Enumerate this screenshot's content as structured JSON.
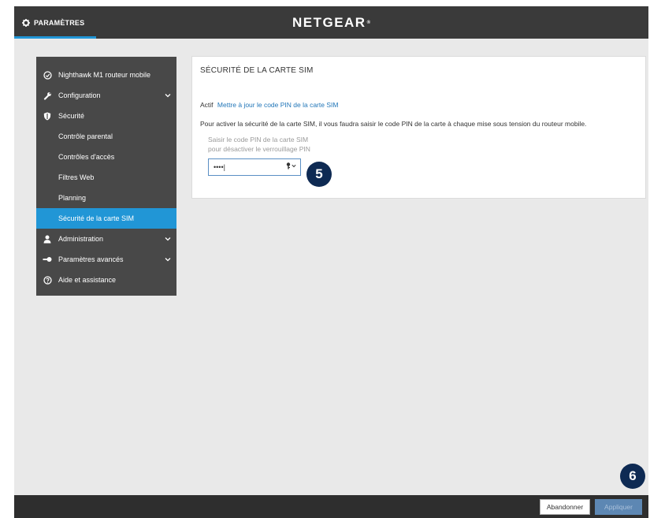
{
  "header": {
    "settings_tab": "PARAMÈTRES",
    "brand": "NETGEAR",
    "brand_mark": "®"
  },
  "sidebar": {
    "items": [
      {
        "label": "Nighthawk M1 routeur mobile",
        "icon": "dashboard-icon"
      },
      {
        "label": "Configuration",
        "icon": "wrench-icon",
        "expandable": true
      },
      {
        "label": "Sécurité",
        "icon": "shield-icon"
      },
      {
        "label": "Contrôle parental"
      },
      {
        "label": "Contrôles d'accès"
      },
      {
        "label": "Filtres Web"
      },
      {
        "label": "Planning"
      },
      {
        "label": "Sécurité de la carte SIM",
        "active": true
      },
      {
        "label": "Administration",
        "icon": "user-icon",
        "expandable": true
      },
      {
        "label": "Paramètres avancés",
        "icon": "key-icon",
        "expandable": true
      },
      {
        "label": "Aide et assistance",
        "icon": "help-icon"
      }
    ]
  },
  "panel": {
    "title": "SÉCURITÉ DE LA CARTE SIM",
    "status": "Actif",
    "update_link": "Mettre à jour le code PIN de la carte SIM",
    "description": "Pour activer la sécurité de la carte SIM, il vous faudra saisir le code PIN de la carte à chaque mise sous tension du routeur mobile.",
    "pin_label": "Saisir le code PIN de la carte SIM pour désactiver le verrouillage PIN",
    "pin_value": "••••|"
  },
  "badges": {
    "step5": "5",
    "step6": "6"
  },
  "footer": {
    "cancel_label": "Abandonner",
    "apply_label": "Appliquer"
  },
  "colors": {
    "accent": "#2196d6",
    "topbar": "#3a3a3a",
    "sidebar": "#484848",
    "badge": "#0e2a53"
  }
}
